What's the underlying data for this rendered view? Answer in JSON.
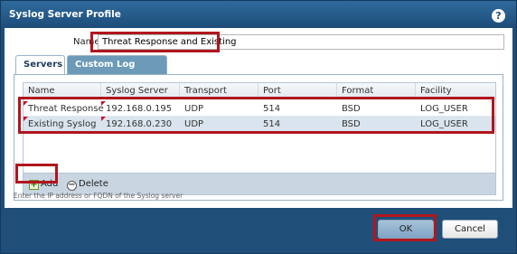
{
  "dialog": {
    "title": "Syslog Server Profile",
    "help_icon": "?"
  },
  "form": {
    "name_label": "Name",
    "name_value": "Threat Response and Existing"
  },
  "tabs": [
    {
      "label": "Servers",
      "active": true
    },
    {
      "label": "Custom Log Format",
      "active": false
    }
  ],
  "table": {
    "headers": [
      "Name",
      "Syslog Server",
      "Transport",
      "Port",
      "Format",
      "Facility"
    ],
    "rows": [
      [
        "Threat Response",
        "192.168.0.195",
        "UDP",
        "514",
        "BSD",
        "LOG_USER"
      ],
      [
        "Existing Syslog",
        "192.168.0.230",
        "UDP",
        "514",
        "BSD",
        "LOG_USER"
      ]
    ]
  },
  "toolbar": {
    "add_label": "Add",
    "delete_label": "Delete",
    "add_icon": "+",
    "delete_icon": "−"
  },
  "hint": "Enter the IP address or FQDN of the Syslog server",
  "buttons": {
    "ok": "OK",
    "cancel": "Cancel"
  },
  "colors": {
    "title_bar": "#1f4e78",
    "highlight": "#b0161d",
    "selected_row": "#d9e4ee",
    "dirty_marker": "#c8102e"
  }
}
